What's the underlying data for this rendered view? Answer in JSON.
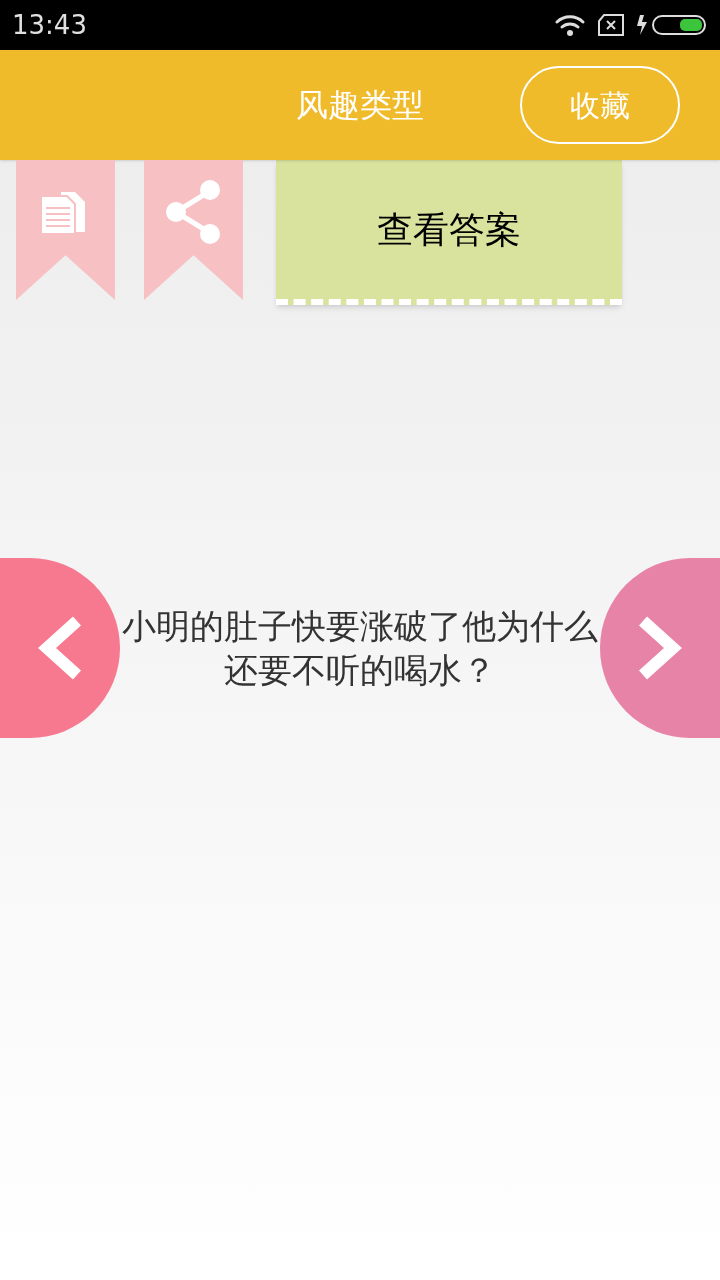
{
  "status_bar": {
    "time": "13:43"
  },
  "header": {
    "title": "风趣类型",
    "favorite_button": "收藏"
  },
  "answer_button": "查看答案",
  "question": "小明的肚子快要涨破了他为什么还要不听的喝水？"
}
